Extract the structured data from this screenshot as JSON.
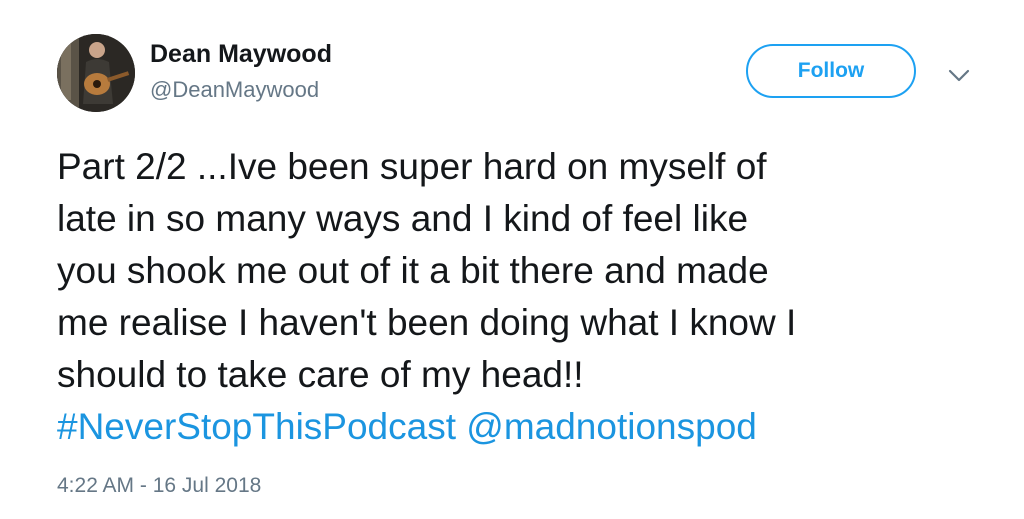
{
  "author": {
    "display_name": "Dean Maywood",
    "handle": "@DeanMaywood",
    "avatar_icon": "profile-photo-guitar"
  },
  "follow_button": {
    "label": "Follow",
    "color": "#1da1f2"
  },
  "menu": {
    "icon": "chevron-down-icon"
  },
  "tweet": {
    "lines": [
      "Part 2/2 ...Ive been super hard on myself of",
      "late in so many ways and I kind of feel like",
      "you shook me out of it a bit there and made",
      "me realise I haven't been doing what I know I",
      "should to take care of my head!!"
    ],
    "hashtag": "#NeverStopThisPodcast",
    "mention": "@madnotionspod",
    "link_color": "#1b95e0"
  },
  "timestamp": "4:22 AM - 16 Jul 2018"
}
